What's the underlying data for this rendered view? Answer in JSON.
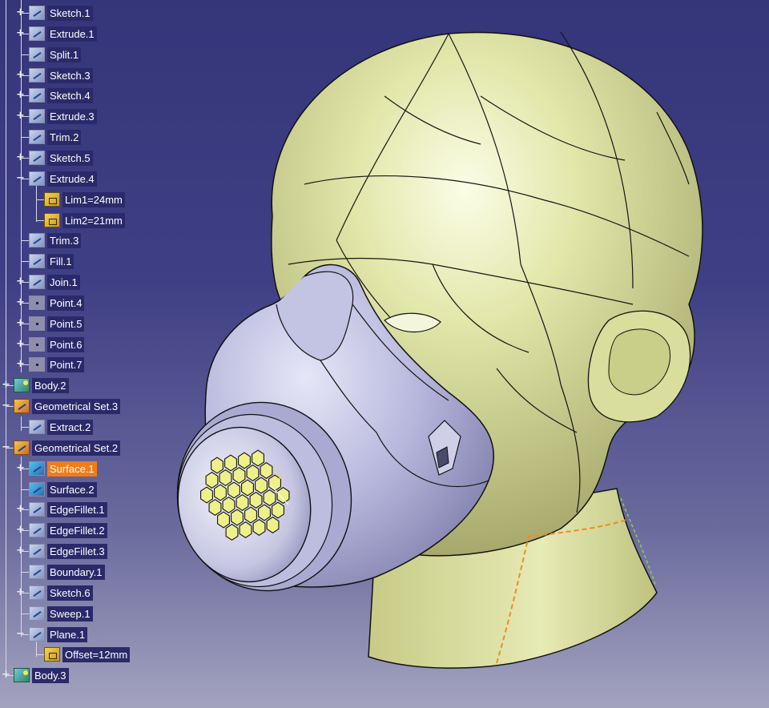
{
  "tree": {
    "items": [
      {
        "label": "Sketch.1",
        "icon": "sketch-icon",
        "kind": "feat"
      },
      {
        "label": "Extrude.1",
        "icon": "extrude-icon",
        "kind": "feat"
      },
      {
        "label": "Split.1",
        "icon": "split-icon",
        "kind": "feat"
      },
      {
        "label": "Sketch.3",
        "icon": "sketch-icon",
        "kind": "feat"
      },
      {
        "label": "Sketch.4",
        "icon": "sketch-icon",
        "kind": "feat"
      },
      {
        "label": "Extrude.3",
        "icon": "extrude-icon",
        "kind": "feat"
      },
      {
        "label": "Trim.2",
        "icon": "trim-icon",
        "kind": "feat"
      },
      {
        "label": "Sketch.5",
        "icon": "sketch-icon",
        "kind": "feat"
      },
      {
        "label": "Extrude.4",
        "icon": "extrude-icon",
        "kind": "feat"
      },
      {
        "label": "Lim1=24mm",
        "icon": "parameter-icon",
        "kind": "param"
      },
      {
        "label": "Lim2=21mm",
        "icon": "parameter-icon",
        "kind": "param"
      },
      {
        "label": "Trim.3",
        "icon": "trim-icon",
        "kind": "feat"
      },
      {
        "label": "Fill.1",
        "icon": "fill-icon",
        "kind": "feat"
      },
      {
        "label": "Join.1",
        "icon": "join-icon",
        "kind": "feat"
      },
      {
        "label": "Point.4",
        "icon": "point-icon",
        "kind": "point"
      },
      {
        "label": "Point.5",
        "icon": "point-icon",
        "kind": "point"
      },
      {
        "label": "Point.6",
        "icon": "point-icon",
        "kind": "point"
      },
      {
        "label": "Point.7",
        "icon": "point-icon",
        "kind": "point"
      },
      {
        "label": "Body.2",
        "icon": "body-icon",
        "kind": "body"
      },
      {
        "label": "Geometrical Set.3",
        "icon": "geometrical-set-icon",
        "kind": "gset"
      },
      {
        "label": "Extract.2",
        "icon": "extract-icon",
        "kind": "feat"
      },
      {
        "label": "Geometrical Set.2",
        "icon": "geometrical-set-icon",
        "kind": "gset"
      },
      {
        "label": "Surface.1",
        "icon": "surface-icon",
        "kind": "surf",
        "selected": true
      },
      {
        "label": "Surface.2",
        "icon": "surface-icon",
        "kind": "surf"
      },
      {
        "label": "EdgeFillet.1",
        "icon": "edge-fillet-icon",
        "kind": "feat"
      },
      {
        "label": "EdgeFillet.2",
        "icon": "edge-fillet-icon",
        "kind": "feat"
      },
      {
        "label": "EdgeFillet.3",
        "icon": "edge-fillet-icon",
        "kind": "feat"
      },
      {
        "label": "Boundary.1",
        "icon": "boundary-icon",
        "kind": "feat"
      },
      {
        "label": "Sketch.6",
        "icon": "sketch-icon",
        "kind": "feat"
      },
      {
        "label": "Sweep.1",
        "icon": "sweep-icon",
        "kind": "feat"
      },
      {
        "label": "Plane.1",
        "icon": "plane-icon",
        "kind": "feat"
      },
      {
        "label": "Offset=12mm",
        "icon": "parameter-icon",
        "kind": "param"
      },
      {
        "label": "Body.3",
        "icon": "body-icon",
        "kind": "body"
      }
    ]
  },
  "colors": {
    "background_top": "#35357a",
    "background_bottom": "#a3a3bf",
    "head": "#dde3a2",
    "mask": "#b9b9dc",
    "selection": "#f07c1a"
  }
}
